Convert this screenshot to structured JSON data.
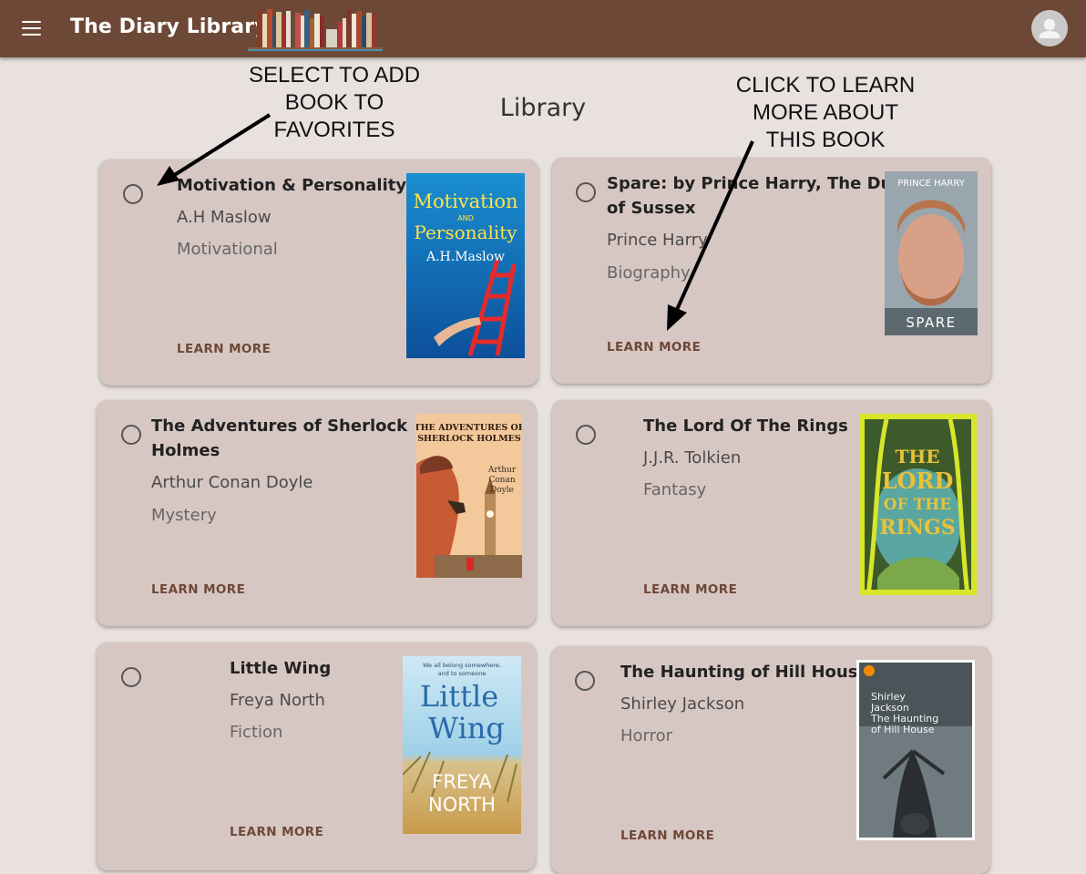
{
  "app": {
    "title": "The Diary Library"
  },
  "page": {
    "title": "Library"
  },
  "annotations": {
    "select": [
      "SELECT TO ADD",
      "BOOK TO",
      "FAVORITES"
    ],
    "learn": [
      "CLICK TO LEARN",
      "MORE ABOUT",
      "THIS BOOK"
    ]
  },
  "books": [
    {
      "title_lines": [
        "Motivation & Personality"
      ],
      "author": "A.H Maslow",
      "genre": "Motivational",
      "action": "LEARN MORE",
      "cover": {
        "lines": [
          "Motivation",
          "AND",
          "Personality",
          "A.H.Maslow"
        ]
      }
    },
    {
      "title_lines": [
        "Spare: by Prince Harry, The Duke",
        "of Sussex"
      ],
      "author": "Prince Harry",
      "genre": "Biography",
      "action": "LEARN MORE",
      "cover": {
        "top": "PRINCE HARRY",
        "bottom": "SPARE"
      }
    },
    {
      "title_lines": [
        "The Adventures of Sherlock",
        "Holmes"
      ],
      "author": "Arthur Conan Doyle",
      "genre": "Mystery",
      "action": "LEARN MORE",
      "cover": {
        "lines": [
          "THE ADVENTURES OF",
          "SHERLOCK HOLMES",
          "Arthur",
          "Conan",
          "Doyle"
        ]
      }
    },
    {
      "title_lines": [
        "The Lord Of The Rings"
      ],
      "author": "J.J.R. Tolkien",
      "genre": "Fantasy",
      "action": "LEARN MORE",
      "cover": {
        "lines": [
          "THE",
          "LORD",
          "OF THE",
          "RINGS"
        ]
      }
    },
    {
      "title_lines": [
        "Little Wing"
      ],
      "author": "Freya North",
      "genre": "Fiction",
      "action": "LEARN MORE",
      "cover": {
        "lines": [
          "We all belong somewhere,",
          "and to someone",
          "Little",
          "Wing",
          "FREYA",
          "NORTH"
        ]
      }
    },
    {
      "title_lines": [
        "The Haunting of Hill House"
      ],
      "author": "Shirley Jackson",
      "genre": "Horror",
      "action": "LEARN MORE",
      "cover": {
        "lines": [
          "Shirley",
          "Jackson",
          "The Haunting",
          "of Hill House"
        ]
      }
    }
  ]
}
